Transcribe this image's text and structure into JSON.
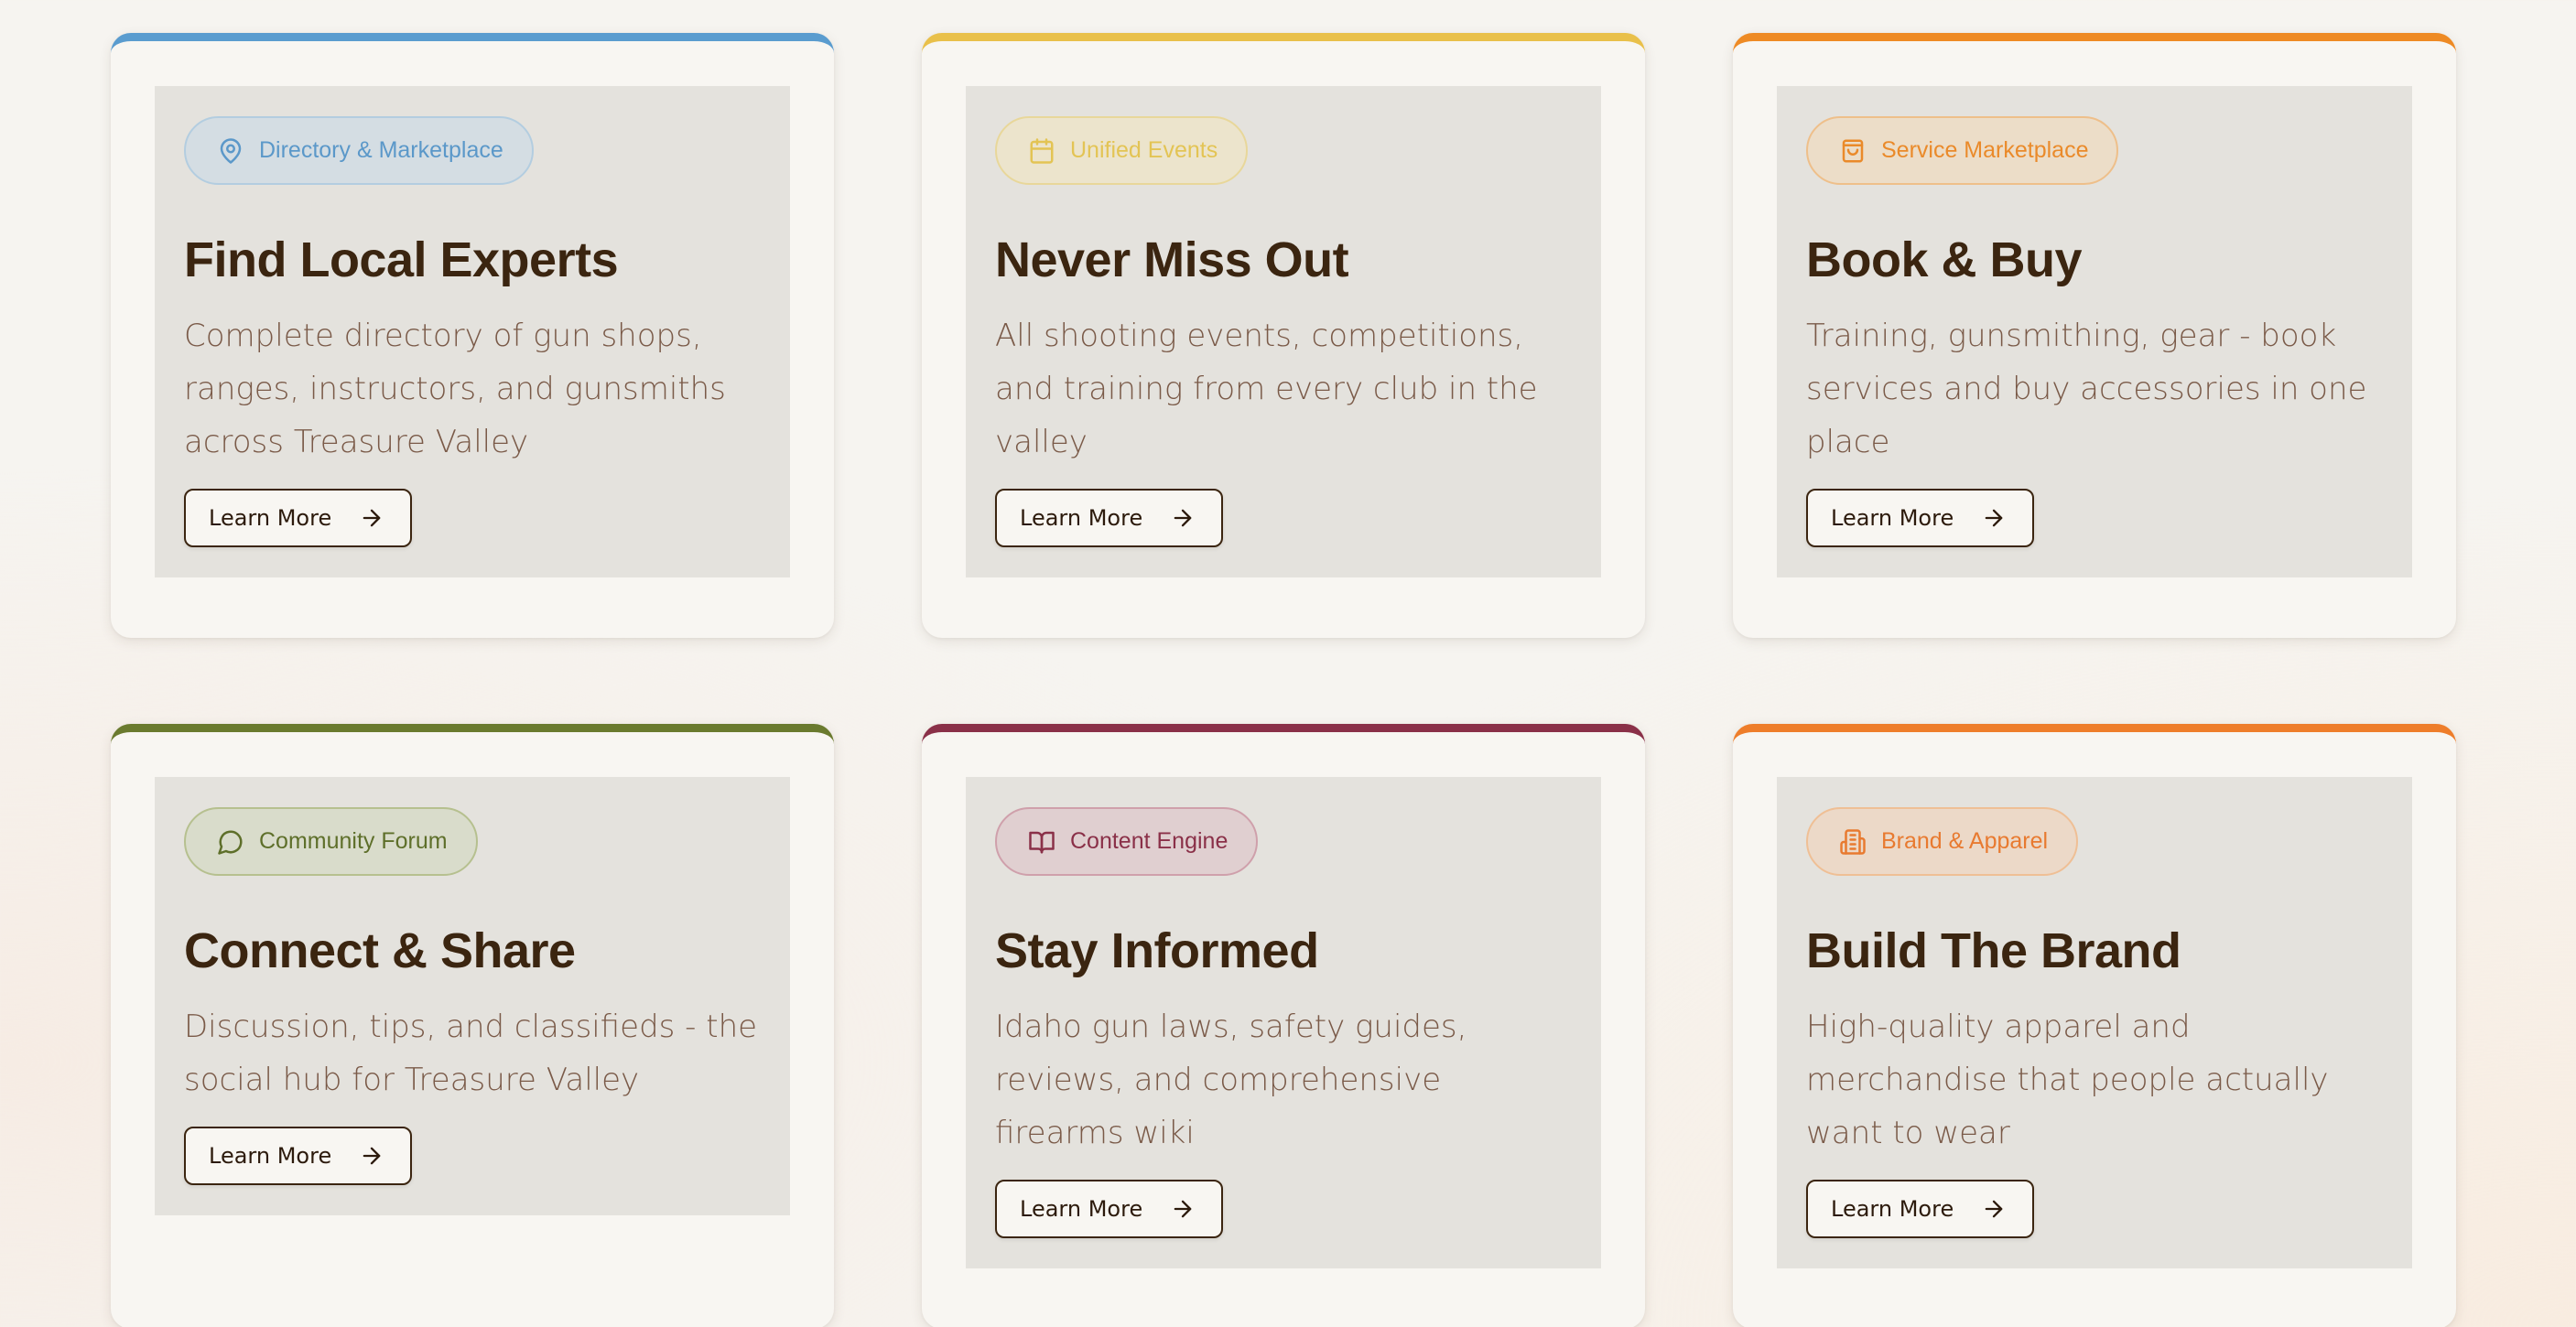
{
  "cards": [
    {
      "accent": "#5a9ccf",
      "badge": {
        "label": "Directory & Marketplace",
        "icon": "map-pin-icon",
        "fg": "#5b98c9",
        "bg": "#d4dde3",
        "border": "#b3cde0"
      },
      "title": "Find Local Experts",
      "description": "Complete directory of gun shops, ranges, instructors, and gunsmiths across Treasure Valley",
      "button": "Learn More"
    },
    {
      "accent": "#e9c04a",
      "badge": {
        "label": "Unified Events",
        "icon": "calendar-icon",
        "fg": "#e3c454",
        "bg": "#ece4cc",
        "border": "#e8d79a"
      },
      "title": "Never Miss Out",
      "description": "All shooting events, competitions, and training from every club in the valley",
      "button": "Learn More"
    },
    {
      "accent": "#ee8a24",
      "badge": {
        "label": "Service Marketplace",
        "icon": "shopping-bag-icon",
        "fg": "#ea8a2a",
        "bg": "#ecddc8",
        "border": "#eebf8a"
      },
      "title": "Book & Buy",
      "description": "Training, gunsmithing, gear - book services and buy accessories in one place",
      "button": "Learn More"
    },
    {
      "accent": "#6a7a2e",
      "badge": {
        "label": "Community Forum",
        "icon": "chat-bubble-icon",
        "fg": "#5e6f2a",
        "bg": "#d9dccb",
        "border": "#b6c08f"
      },
      "title": "Connect & Share",
      "description": "Discussion, tips, and classifieds - the social hub for Treasure Valley",
      "button": "Learn More"
    },
    {
      "accent": "#8a3048",
      "badge": {
        "label": "Content Engine",
        "icon": "open-book-icon",
        "fg": "#8a3048",
        "bg": "#e0cfd0",
        "border": "#cfa0ab"
      },
      "title": "Stay Informed",
      "description": "Idaho gun laws, safety guides, reviews, and comprehensive firearms wiki",
      "button": "Learn More"
    },
    {
      "accent": "#ee7d2a",
      "badge": {
        "label": "Brand & Apparel",
        "icon": "building-icon",
        "fg": "#e87a30",
        "bg": "#ecd9c8",
        "border": "#efbf95"
      },
      "title": "Build The Brand",
      "description": "High-quality apparel and merchandise that people actually want to wear",
      "button": "Learn More"
    }
  ]
}
